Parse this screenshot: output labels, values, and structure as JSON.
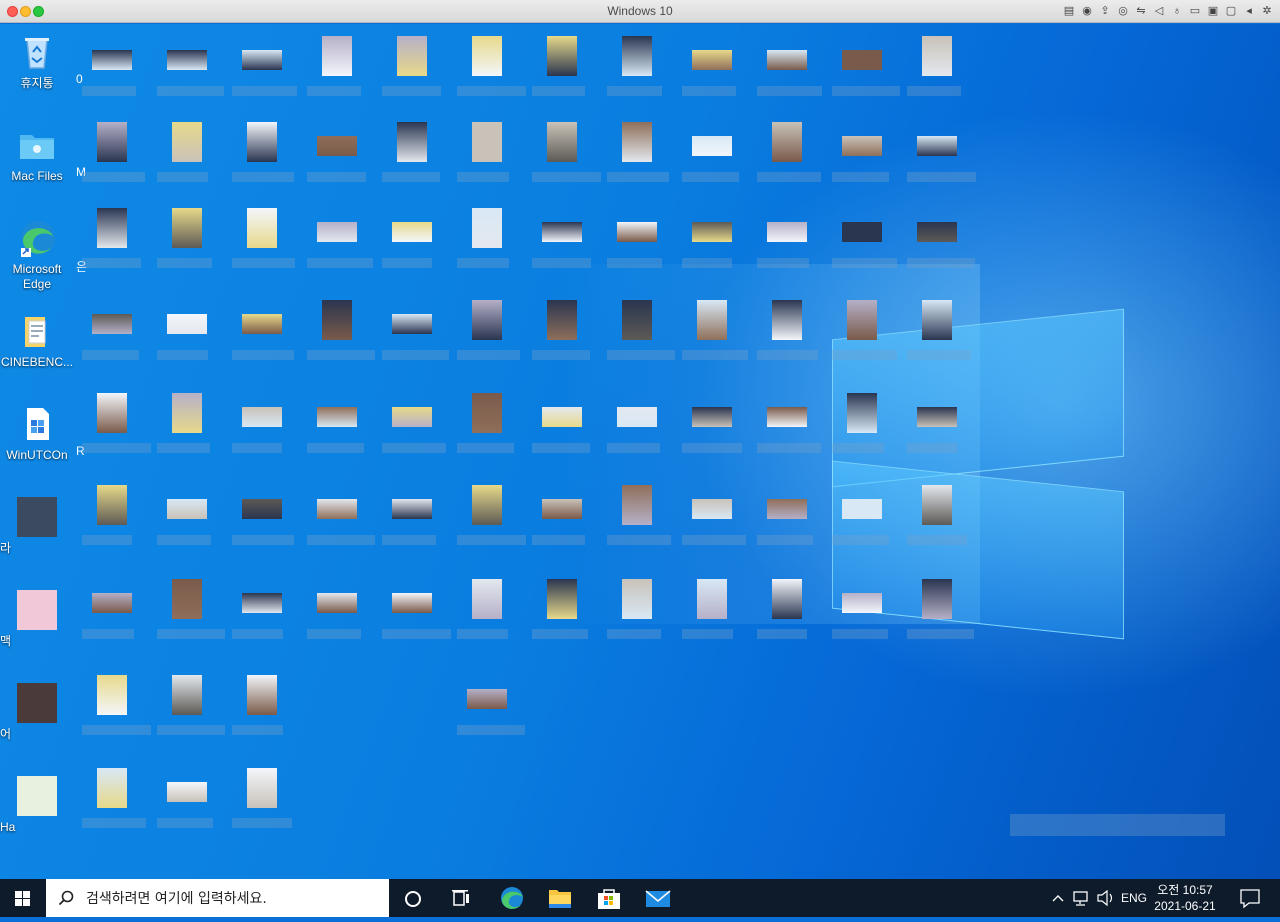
{
  "window": {
    "title": "Windows 10"
  },
  "desktop": {
    "icons": [
      {
        "label": "휴지통",
        "icon": "recycle-bin-icon"
      },
      {
        "label": "Mac Files",
        "icon": "folder-icon"
      },
      {
        "label": "Microsoft Edge",
        "icon": "edge-icon"
      },
      {
        "label": "CINEBENC...",
        "icon": "folder-icon"
      },
      {
        "label": "WinUTCOn",
        "icon": "app-icon"
      },
      {
        "label": "라",
        "icon": "file-icon"
      },
      {
        "label": "맥",
        "icon": "file-icon"
      },
      {
        "label": "어",
        "icon": "file-icon"
      },
      {
        "label": "Ha",
        "icon": "file-icon"
      }
    ],
    "partial_labels": [
      "0",
      "M",
      "은",
      "R"
    ]
  },
  "taskbar": {
    "search_placeholder": "검색하려면 여기에 입력하세요.",
    "language": "ENG",
    "time": "오전 10:57",
    "date": "2021-06-21"
  },
  "colors": {
    "taskbar": "#0d1b2a",
    "desktop_accent": "#0a7ee0"
  }
}
